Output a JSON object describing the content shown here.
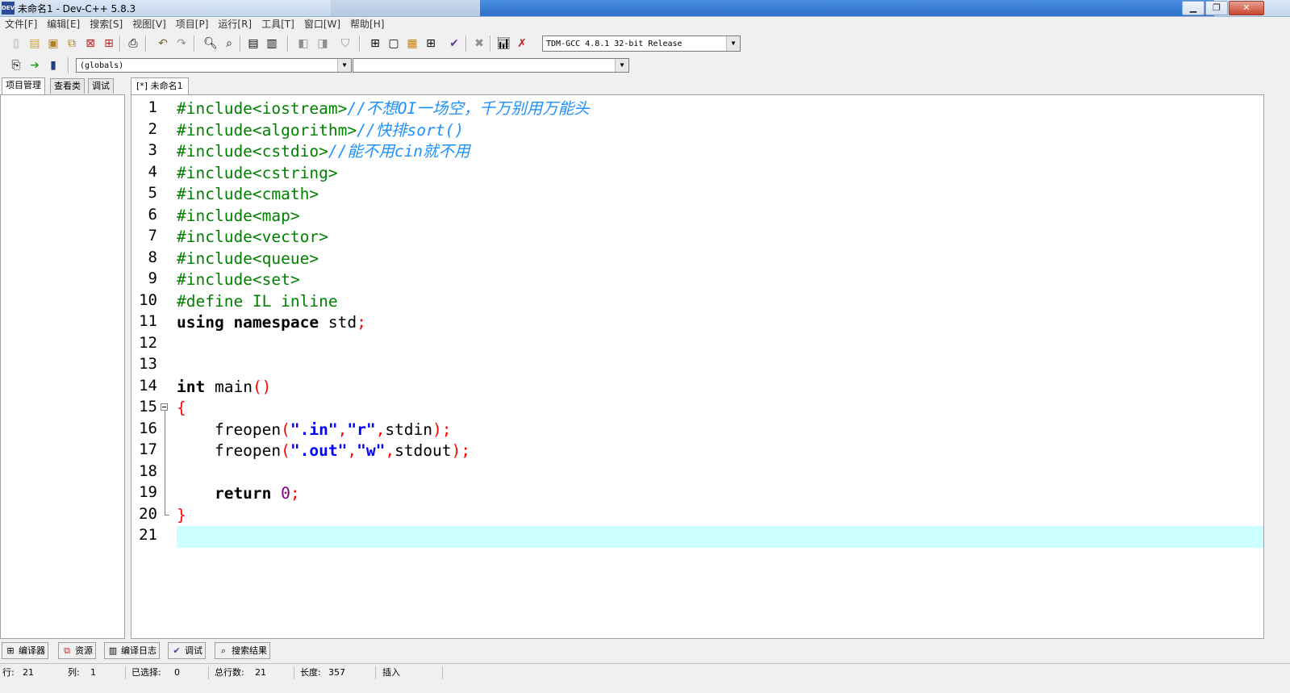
{
  "window": {
    "title": "未命名1 - Dev-C++ 5.8.3",
    "icon_label": "DEV"
  },
  "menu": [
    "文件[F]",
    "编辑[E]",
    "搜索[S]",
    "视图[V]",
    "项目[P]",
    "运行[R]",
    "工具[T]",
    "窗口[W]",
    "帮助[H]"
  ],
  "toolbar": {
    "compiler_select": "TDM-GCC 4.8.1 32-bit Release",
    "scope_select": "(globals)",
    "member_select": ""
  },
  "left_tabs": [
    "项目管理",
    "查看类",
    "调试"
  ],
  "editor": {
    "tab_label": "[*] 未命名1",
    "current_line": 21,
    "lines": [
      {
        "n": "1"
      },
      {
        "n": "2"
      },
      {
        "n": "3"
      },
      {
        "n": "4"
      },
      {
        "n": "5"
      },
      {
        "n": "6"
      },
      {
        "n": "7"
      },
      {
        "n": "8"
      },
      {
        "n": "9"
      },
      {
        "n": "10"
      },
      {
        "n": "11"
      },
      {
        "n": "12"
      },
      {
        "n": "13"
      },
      {
        "n": "14"
      },
      {
        "n": "15"
      },
      {
        "n": "16"
      },
      {
        "n": "17"
      },
      {
        "n": "18"
      },
      {
        "n": "19"
      },
      {
        "n": "20"
      },
      {
        "n": "21"
      }
    ],
    "code": {
      "l1_pp": "#include<iostream>",
      "l1_cm": "//不想OI一场空，千万别用万能头",
      "l2_pp": "#include<algorithm>",
      "l2_cm": "//快排sort()",
      "l3_pp": "#include<cstdio>",
      "l3_cm": "//能不用cin就不用",
      "l4_pp": "#include<cstring>",
      "l5_pp": "#include<cmath>",
      "l6_pp": "#include<map>",
      "l7_pp": "#include<vector>",
      "l8_pp": "#include<queue>",
      "l9_pp": "#include<set>",
      "l10_pp": "#define IL inline",
      "l11_kw": "using namespace",
      "l11_id": " std",
      "l11_sym": ";",
      "l14_kw": "int",
      "l14_id": " main",
      "l14_sym": "()",
      "l15_sym": "{",
      "l16_a": "    freopen",
      "l16_b": "(",
      "l16_c": "\".in\"",
      "l16_d": ",",
      "l16_e": "\"r\"",
      "l16_f": ",",
      "l16_g": "stdin",
      "l16_h": ");",
      "l17_a": "    freopen",
      "l17_b": "(",
      "l17_c": "\".out\"",
      "l17_d": ",",
      "l17_e": "\"w\"",
      "l17_f": ",",
      "l17_g": "stdout",
      "l17_h": ");",
      "l19_kw": "    return",
      "l19_num": " 0",
      "l19_sym": ";",
      "l20_sym": "}"
    }
  },
  "bottom_tabs": [
    {
      "label": "编译器",
      "icon": "compiler-grid-icon"
    },
    {
      "label": "资源",
      "icon": "resources-icon"
    },
    {
      "label": "编译日志",
      "icon": "compile-log-chart-icon"
    },
    {
      "label": "调试",
      "icon": "debug-check-icon"
    },
    {
      "label": "搜索结果",
      "icon": "search-results-icon"
    }
  ],
  "status": {
    "row_label": "行:",
    "row_value": "21",
    "col_label": "列:",
    "col_value": "1",
    "sel_label": "已选择:",
    "sel_value": "0",
    "total_label": "总行数:",
    "total_value": "21",
    "len_label": "长度:",
    "len_value": "357",
    "mode": "插入"
  },
  "colors": {
    "preprocessor": "#008000",
    "comment": "#1e90ff",
    "string": "#0000ff",
    "symbol": "#ff0000",
    "number": "#800080",
    "current_line": "#ccffff"
  }
}
